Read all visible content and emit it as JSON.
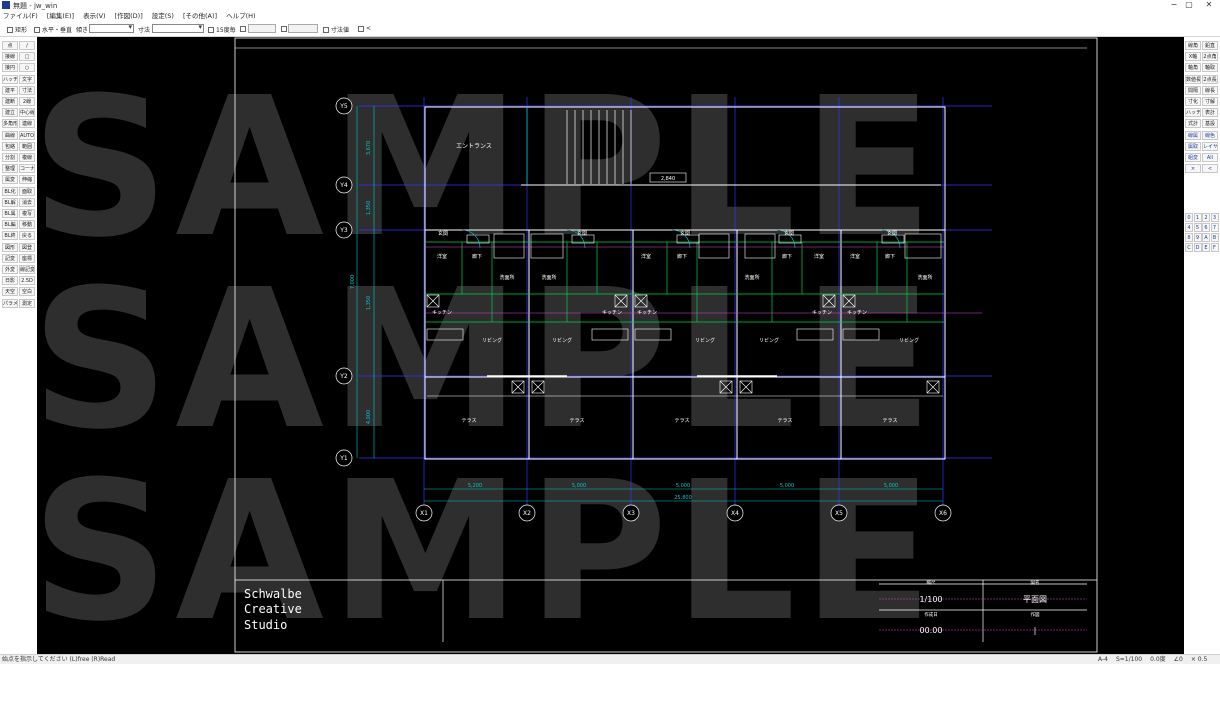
{
  "window": {
    "title": "無題 - jw_win",
    "buttons": {
      "minimize": "−",
      "restore": "▢",
      "close": "✕"
    }
  },
  "menu": [
    "ファイル(F)",
    "[編集(E)]",
    "表示(V)",
    "[作図(D)]",
    "設定(S)",
    "[その他(A)]",
    "ヘルプ(H)"
  ],
  "options": {
    "rect": "矩形",
    "horizontal_vertical": "水平・垂直",
    "angle_label": "傾き",
    "dimension_label": "寸法",
    "angle15": "15度毎",
    "field1": "",
    "field2": "",
    "dim_value": "寸法値",
    "arrow": "<"
  },
  "left_tools": [
    "点",
    "/",
    "接線",
    "□",
    "接円",
    "○",
    "ハッチ",
    "文字",
    "建平",
    "寸法",
    "建断",
    "2線",
    "建立",
    "中心線",
    "多角形",
    "連線",
    "曲線",
    "AUTO",
    "包絡",
    "範囲",
    "分割",
    "複線",
    "整理",
    "コーナー",
    "属変",
    "伸縮",
    "BL化",
    "面取",
    "BL解",
    "消去",
    "BL属",
    "複写",
    "BL編",
    "移動",
    "BL終",
    "戻る",
    "図形",
    "図登",
    "記変",
    "座標",
    "外変",
    "線記変",
    "日影",
    "2.5D",
    "天空",
    "空白",
    "パラメ",
    "測定"
  ],
  "right_tools": [
    "線角",
    "鉛直",
    "X軸",
    "2点角",
    "軸角",
    "軸取",
    "数値長",
    "2点長",
    "間隔",
    "線長",
    "寸化",
    "寸解",
    "ハッチ",
    "表計",
    "式計",
    "基設",
    "線属",
    "線色",
    "属取",
    "レイヤ",
    "組変",
    "All",
    "×",
    "<"
  ],
  "layers": [
    "0",
    "1",
    "2",
    "3",
    "4",
    "5",
    "6",
    "7",
    "8",
    "9",
    "A",
    "B",
    "C",
    "D",
    "E",
    "F"
  ],
  "watermark": "SAMPLE",
  "drawing": {
    "grid_y": [
      "Y5",
      "Y4",
      "Y3",
      "Y2",
      "Y1"
    ],
    "grid_x": [
      "X1",
      "X2",
      "X3",
      "X4",
      "X5",
      "X6"
    ],
    "vertical_dims": [
      "3,670",
      "1,350",
      "1,350",
      "4,000",
      "4,000"
    ],
    "overall_vertical": "7,000",
    "horizontal_dims": [
      "5,200",
      "5,000",
      "5,000",
      "5,000",
      "5,000"
    ],
    "overall_horizontal": "25,800",
    "entrance": "エントランス",
    "stair_note": "2,840",
    "genkan": "玄関",
    "room_labels": [
      "洋室",
      "廊下",
      "洗面所",
      "キッチン",
      "リビング",
      "テラス"
    ],
    "terrace": "テラス"
  },
  "title_block": {
    "company_line1": "Schwalbe",
    "company_line2": "Creative",
    "company_line3": "Studio",
    "scale_header": "縮尺",
    "scale_value": "1/100",
    "title_header": "図名",
    "title_value": "平面図",
    "date_header": "作成日",
    "date_value": "00.00",
    "drawn_header": "作図",
    "drawn_value": "|"
  },
  "status": {
    "message": "始点を指示してください (L)free (R)Read",
    "items": [
      "A-4",
      "S=1/100",
      "0.0度",
      "∠0",
      "× 0.5"
    ]
  }
}
